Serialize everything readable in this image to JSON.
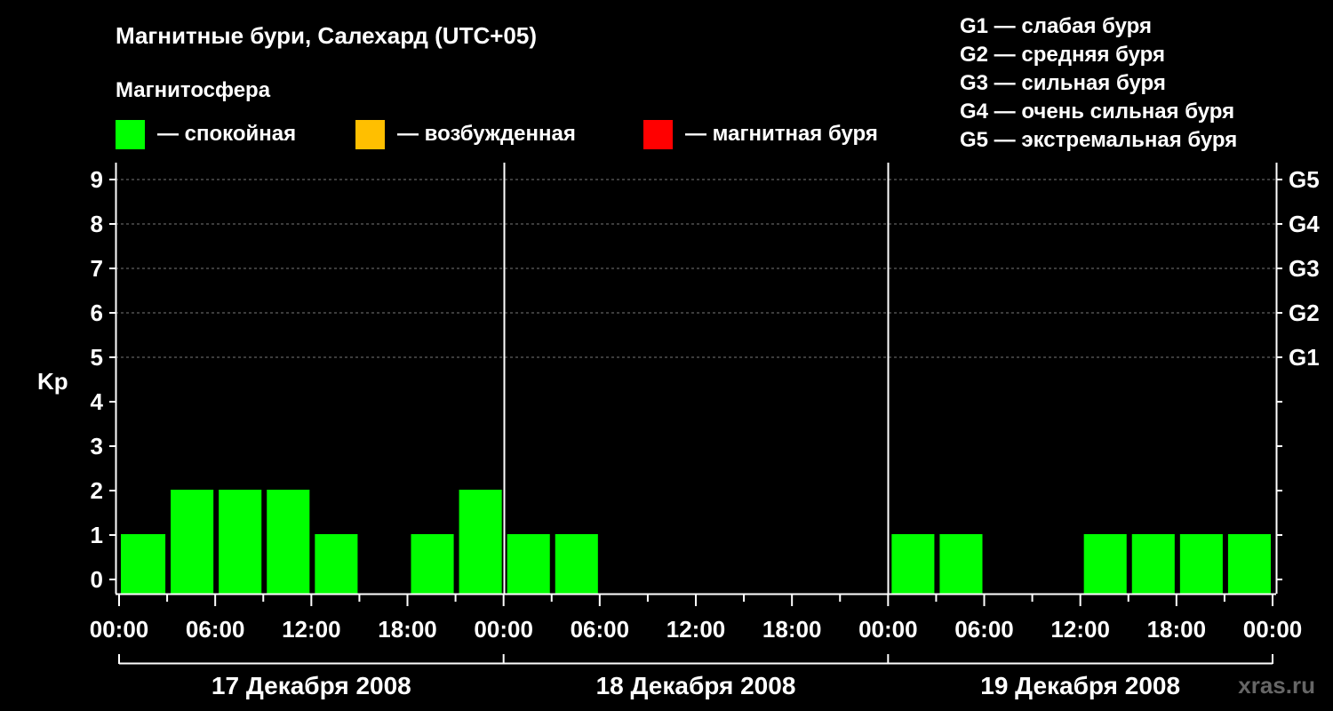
{
  "header": {
    "title": "Магнитные бури, Салехард (UTC+05)",
    "subtitle": "Магнитосфера"
  },
  "legend": {
    "states": [
      {
        "label": "— спокойная",
        "color": "#00ff00"
      },
      {
        "label": "— возбужденная",
        "color": "#ffbf00"
      },
      {
        "label": "— магнитная буря",
        "color": "#ff0000"
      }
    ],
    "storm_levels": [
      "G1 — слабая буря",
      "G2 — средняя буря",
      "G3 — сильная буря",
      "G4 — очень сильная буря",
      "G5 — экстремальная буря"
    ]
  },
  "watermark": "xras.ru",
  "chart_data": {
    "type": "bar",
    "title": "Магнитные бури, Салехард (UTC+05)",
    "ylabel": "Kp",
    "ylim": [
      0,
      9
    ],
    "y_ticks": [
      "0",
      "1",
      "2",
      "3",
      "4",
      "5",
      "6",
      "7",
      "8",
      "9"
    ],
    "right_ticks": [
      {
        "kp": 5,
        "label": "G1"
      },
      {
        "kp": 6,
        "label": "G2"
      },
      {
        "kp": 7,
        "label": "G3"
      },
      {
        "kp": 8,
        "label": "G4"
      },
      {
        "kp": 9,
        "label": "G5"
      }
    ],
    "x_tick_labels": [
      "00:00",
      "06:00",
      "12:00",
      "18:00",
      "00:00",
      "06:00",
      "12:00",
      "18:00",
      "00:00",
      "06:00",
      "12:00",
      "18:00",
      "00:00"
    ],
    "day_labels": [
      "17 Декабря 2008",
      "18 Декабря 2008",
      "19 Декабря 2008"
    ],
    "categories": [
      "17.12 00:00",
      "17.12 03:00",
      "17.12 06:00",
      "17.12 09:00",
      "17.12 12:00",
      "17.12 15:00",
      "17.12 18:00",
      "17.12 21:00",
      "18.12 00:00",
      "18.12 03:00",
      "18.12 06:00",
      "18.12 09:00",
      "18.12 12:00",
      "18.12 15:00",
      "18.12 18:00",
      "18.12 21:00",
      "19.12 00:00",
      "19.12 03:00",
      "19.12 06:00",
      "19.12 09:00",
      "19.12 12:00",
      "19.12 15:00",
      "19.12 18:00",
      "19.12 21:00"
    ],
    "values": [
      1,
      2,
      2,
      2,
      1,
      0,
      1,
      2,
      1,
      1,
      0,
      0,
      0,
      0,
      0,
      0,
      1,
      1,
      0,
      0,
      1,
      1,
      1,
      1
    ],
    "bar_color": "#00ff00",
    "grid": "dashed horizontal at integer Kp from 5 to 9"
  }
}
